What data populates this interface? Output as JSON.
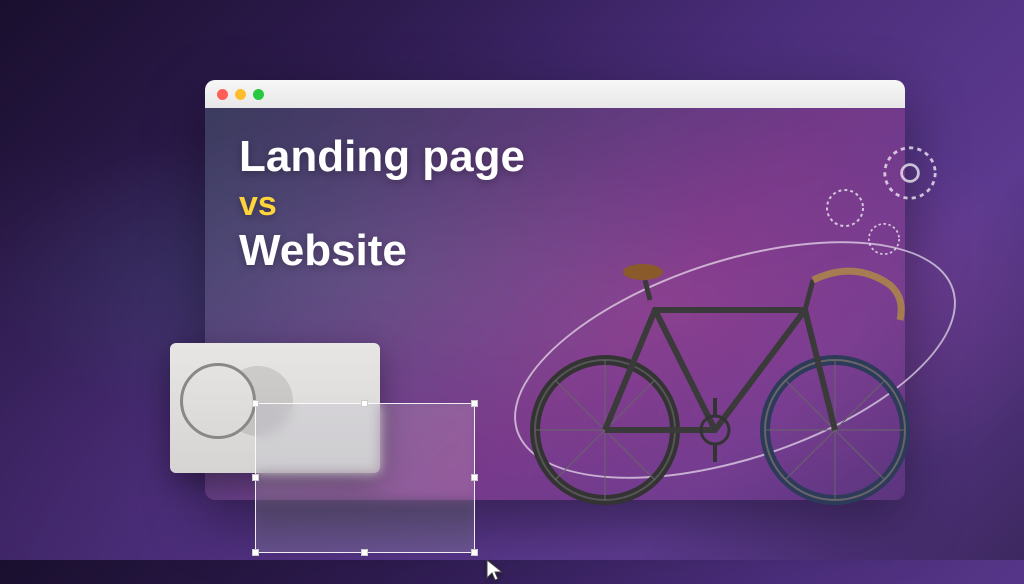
{
  "headline": {
    "line1": "Landing page",
    "vs": "vs",
    "line2": "Website"
  },
  "window": {
    "close": "close",
    "minimize": "minimize",
    "maximize": "maximize"
  },
  "icons": {
    "gear": "gear-icon",
    "cursor": "cursor-icon",
    "bicycle": "bicycle-icon"
  }
}
